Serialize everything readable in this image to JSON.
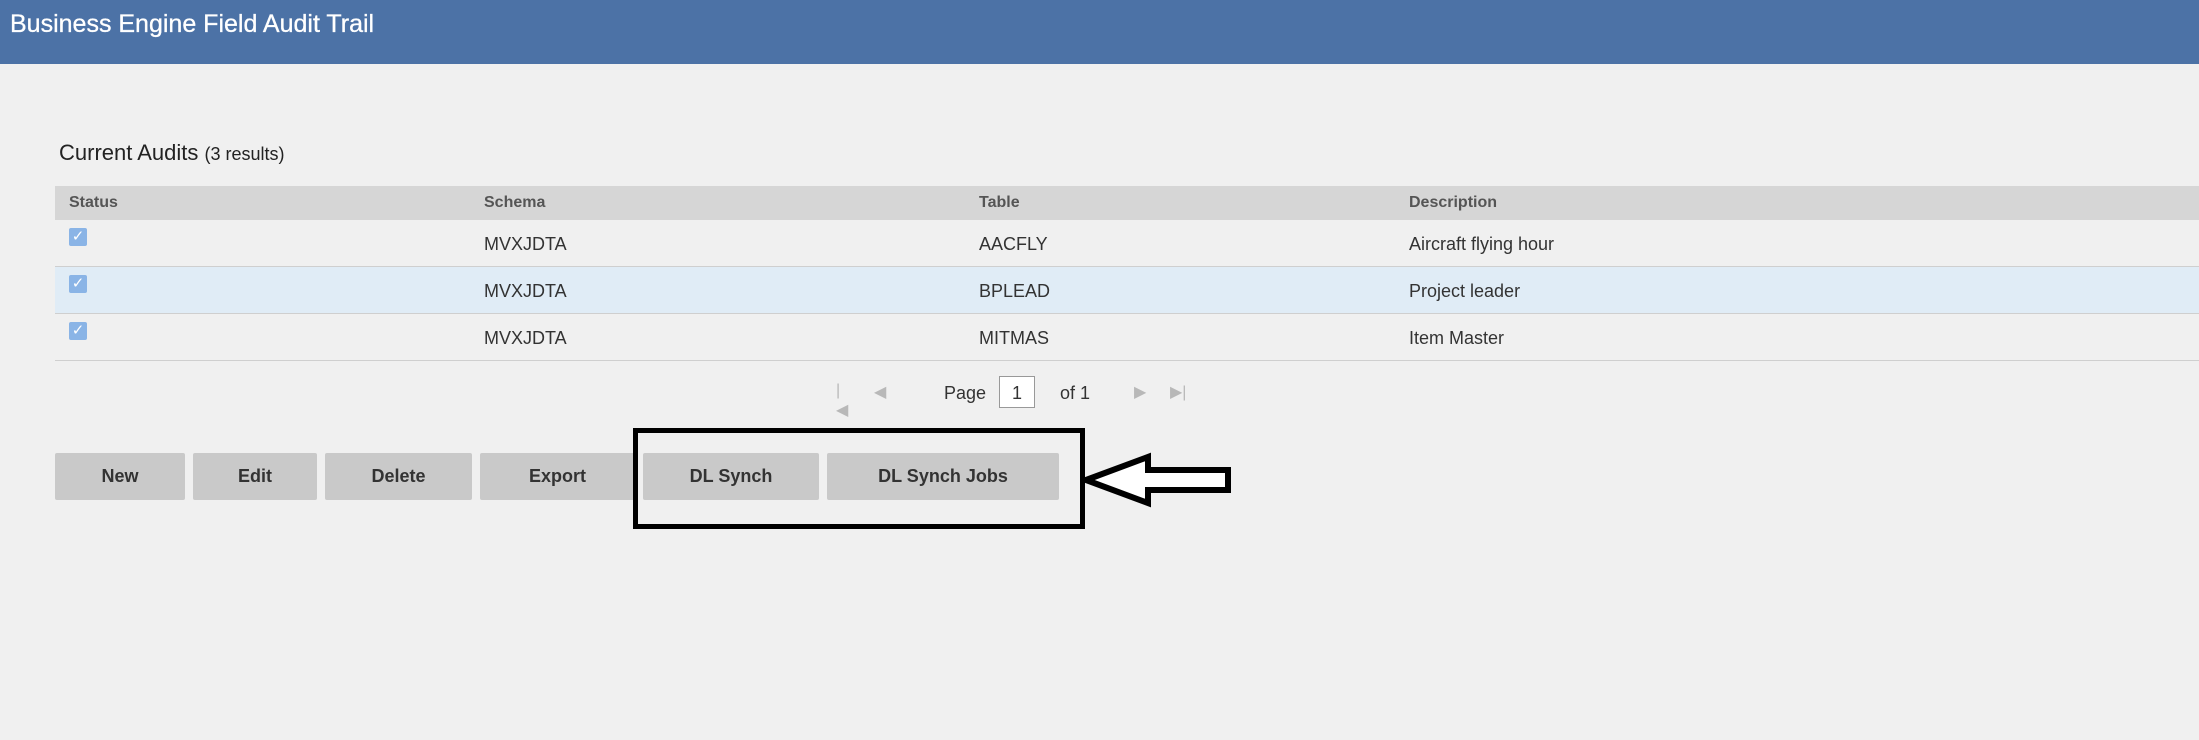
{
  "header": {
    "title": "Business Engine Field Audit Trail"
  },
  "section": {
    "title": "Current Audits",
    "count": "(3 results)"
  },
  "grid": {
    "columns": [
      "Status",
      "Schema",
      "Table",
      "Description"
    ],
    "rows": [
      {
        "status_checked": true,
        "schema": "MVXJDTA",
        "table": "AACFLY",
        "description": "Aircraft flying hour"
      },
      {
        "status_checked": true,
        "schema": "MVXJDTA",
        "table": "BPLEAD",
        "description": "Project leader"
      },
      {
        "status_checked": true,
        "schema": "MVXJDTA",
        "table": "MITMAS",
        "description": "Item Master"
      }
    ]
  },
  "pager": {
    "page_label": "Page",
    "current_page": "1",
    "of_label": "of 1"
  },
  "buttons": {
    "new": "New",
    "edit": "Edit",
    "delete": "Delete",
    "export": "Export",
    "dl_synch": "DL Synch",
    "dl_synch_jobs": "DL Synch Jobs"
  },
  "icons": {
    "checkbox": "check-icon",
    "first_page": "first-page-icon",
    "prev_page": "prev-page-icon",
    "next_page": "next-page-icon",
    "last_page": "last-page-icon",
    "annotation_arrow": "left-arrow-icon"
  },
  "colors": {
    "title_bar": "#4c72a6",
    "header_row": "#d6d6d6",
    "selected_row": "#e0ecf6",
    "button": "#c9c9c9",
    "checkbox": "#8ab4e6"
  }
}
